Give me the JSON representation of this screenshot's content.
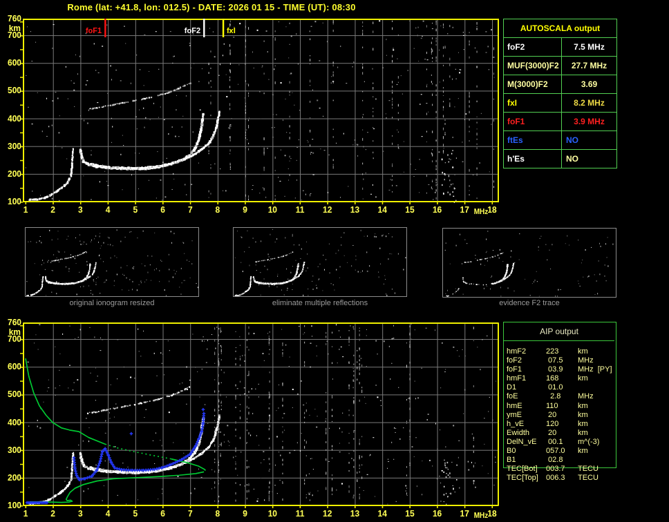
{
  "title": "Rome (lat: +41.8, lon: 012.5) - DATE: 2026 01 15 - TIME (UT): 08:30",
  "colors": {
    "background": "#000000",
    "plot_border": "#f0f000",
    "grid": "#7b7b7b",
    "axis_text": "#ffff55",
    "title_text": "#ffff2e",
    "trace_white": "#ffffff",
    "trace_gray": "#c0c0c0",
    "restored_blue": "#2437f0",
    "profile_green": "#00c832",
    "table_green": "#52d052",
    "caption_gray": "#9c9c9c"
  },
  "autoscala_table": {
    "header": "AUTOSCALA output",
    "rows": [
      {
        "label": "foF2",
        "value": "7.5 MHz",
        "label_color": "#ffffff",
        "value_color": "#ffffff",
        "align": "center"
      },
      {
        "label": "MUF(3000)F2",
        "value": "27.7 MHz",
        "label_color": "#ffffa2",
        "value_color": "#ffffa2",
        "align": "center"
      },
      {
        "label": "M(3000)F2",
        "value": "3.69",
        "label_color": "#ffffa2",
        "value_color": "#ffffa2",
        "align": "center"
      },
      {
        "label": "fxI",
        "value": "8.2 MHz",
        "label_color": "#ffff00",
        "value_color": "#eeda45",
        "align": "center"
      },
      {
        "label": "foF1",
        "value": "3.9 MHz",
        "label_color": "#ff2020",
        "value_color": "#ff2020",
        "align": "center"
      },
      {
        "label": "ftEs",
        "value": "NO",
        "label_color": "#2a62ff",
        "value_color": "#2a62ff",
        "align": "left"
      },
      {
        "label": "h'Es",
        "value": "NO",
        "label_color": "#ffffff",
        "value_color": "#ffffa2",
        "align": "left"
      }
    ]
  },
  "aip_table": {
    "header": "AIP output",
    "rows": [
      {
        "label": "hmF2",
        "value": "223",
        "unit": "km"
      },
      {
        "label": "foF2",
        "value": " 07.5",
        "unit": "MHz"
      },
      {
        "label": "foF1",
        "value": " 03.9",
        "unit": "MHz  [PY]"
      },
      {
        "label": "hmF1",
        "value": "168",
        "unit": "km"
      },
      {
        "label": "D1",
        "value": " 01.0",
        "unit": ""
      },
      {
        "label": "foE",
        "value": "  2.8",
        "unit": "MHz"
      },
      {
        "label": "hmE",
        "value": "110",
        "unit": "km"
      },
      {
        "label": "ymE",
        "value": " 20",
        "unit": "km"
      },
      {
        "label": "h_vE",
        "value": "120",
        "unit": "km"
      },
      {
        "label": "Ewidth",
        "value": " 20",
        "unit": "km"
      },
      {
        "label": "DelN_vE",
        "value": " 00.1",
        "unit": "m^(-3)"
      },
      {
        "label": "B0",
        "value": "057.0",
        "unit": "km"
      },
      {
        "label": "B1",
        "value": " 02.8",
        "unit": ""
      },
      {
        "label": "TEC[Bot]",
        "value": "003.7",
        "unit": "TECU"
      },
      {
        "label": "TEC[Top]",
        "value": "006.3",
        "unit": "TECU"
      }
    ]
  },
  "thumbnails": [
    {
      "caption": "original ionogram resized"
    },
    {
      "caption": "eliminate multiple reflections"
    },
    {
      "caption": "evidence F2 trace"
    }
  ],
  "chart_data": {
    "type": "scatter",
    "title": "ionogram: virtual height (km) vs frequency (MHz), two panels",
    "x_unit": "MHz",
    "y_unit": "km",
    "xlim": [
      1,
      18.25
    ],
    "ylim": [
      100,
      760
    ],
    "x_ticks": [
      1,
      2,
      3,
      4,
      5,
      6,
      7,
      8,
      9,
      10,
      11,
      12,
      13,
      14,
      15,
      16,
      17,
      18
    ],
    "y_ticks": [
      760,
      700,
      600,
      500,
      400,
      300,
      200,
      100
    ],
    "grid": {
      "x_step_mhz": 1,
      "y_step_km": 100
    },
    "markers": [
      {
        "label": "foF1",
        "freq_mhz": 3.9,
        "color": "#ff1414",
        "side": "left"
      },
      {
        "label": "foF2",
        "freq_mhz": 7.5,
        "color": "#ffffff",
        "side": "left"
      },
      {
        "label": "fxI",
        "freq_mhz": 8.2,
        "color": "#ffff00",
        "side": "right"
      }
    ],
    "traces": {
      "E_layer": [
        [
          1.15,
          106
        ],
        [
          1.4,
          108
        ],
        [
          1.7,
          113
        ],
        [
          1.9,
          122
        ],
        [
          2.1,
          135
        ],
        [
          2.3,
          148
        ],
        [
          2.45,
          160
        ],
        [
          2.55,
          172
        ],
        [
          2.62,
          186
        ]
      ],
      "EF_cusp": [
        [
          2.66,
          190
        ],
        [
          2.68,
          215
        ],
        [
          2.7,
          242
        ],
        [
          2.72,
          268
        ],
        [
          2.74,
          292
        ]
      ],
      "F_ordinary": [
        [
          3.0,
          287
        ],
        [
          3.05,
          260
        ],
        [
          3.12,
          244
        ],
        [
          3.3,
          233
        ],
        [
          3.6,
          226
        ],
        [
          4.0,
          222
        ],
        [
          4.5,
          219
        ],
        [
          5.0,
          218
        ],
        [
          5.5,
          220
        ],
        [
          5.9,
          226
        ],
        [
          6.3,
          235
        ],
        [
          6.7,
          250
        ],
        [
          7.0,
          270
        ],
        [
          7.2,
          295
        ],
        [
          7.32,
          325
        ],
        [
          7.4,
          358
        ],
        [
          7.45,
          392
        ],
        [
          7.48,
          418
        ]
      ],
      "F_extraordinary": [
        [
          3.35,
          237
        ],
        [
          3.7,
          229
        ],
        [
          4.1,
          224
        ],
        [
          4.6,
          221
        ],
        [
          5.1,
          221
        ],
        [
          5.6,
          224
        ],
        [
          6.0,
          230
        ],
        [
          6.4,
          240
        ],
        [
          6.8,
          253
        ],
        [
          7.15,
          270
        ],
        [
          7.45,
          290
        ],
        [
          7.7,
          312
        ],
        [
          7.85,
          338
        ],
        [
          7.95,
          368
        ],
        [
          8.02,
          398
        ],
        [
          8.07,
          425
        ]
      ],
      "second_hop": [
        [
          3.2,
          432
        ],
        [
          3.6,
          438
        ],
        [
          4.0,
          445
        ],
        [
          4.5,
          455
        ],
        [
          5.0,
          464
        ],
        [
          5.5,
          474
        ],
        [
          6.0,
          487
        ],
        [
          6.4,
          500
        ],
        [
          6.75,
          515
        ],
        [
          7.0,
          528
        ]
      ]
    },
    "restored_trace_blue": {
      "E_flat": {
        "f_start": 1.05,
        "f_end": 1.82,
        "h": 110
      },
      "main": [
        [
          2.76,
          272
        ],
        [
          2.8,
          232
        ],
        [
          2.86,
          208
        ],
        [
          2.96,
          193
        ],
        [
          3.17,
          197
        ],
        [
          3.42,
          206
        ],
        [
          3.6,
          228
        ],
        [
          3.72,
          260
        ],
        [
          3.8,
          295
        ],
        [
          3.9,
          305
        ],
        [
          4.02,
          280
        ],
        [
          4.12,
          255
        ],
        [
          4.25,
          235
        ],
        [
          4.5,
          229
        ],
        [
          4.9,
          227
        ],
        [
          5.3,
          227
        ],
        [
          5.7,
          230
        ],
        [
          6.0,
          237
        ],
        [
          6.3,
          248
        ],
        [
          6.7,
          266
        ],
        [
          7.0,
          285
        ],
        [
          7.2,
          315
        ],
        [
          7.32,
          342
        ],
        [
          7.42,
          368
        ],
        [
          7.47,
          398
        ],
        [
          7.5,
          438
        ]
      ],
      "outliers": [
        [
          4.85,
          359
        ],
        [
          7.47,
          446
        ]
      ]
    },
    "profile_green": {
      "topside": [
        [
          1.0,
          630
        ],
        [
          1.12,
          565
        ],
        [
          1.3,
          505
        ],
        [
          1.5,
          460
        ],
        [
          1.75,
          425
        ],
        [
          2.0,
          398
        ],
        [
          2.3,
          380
        ],
        [
          2.6,
          372
        ],
        [
          2.95,
          366
        ],
        [
          3.3,
          345
        ],
        [
          3.9,
          321
        ],
        [
          4.4,
          306
        ],
        [
          5.0,
          293
        ],
        [
          5.6,
          281
        ],
        [
          6.3,
          268
        ],
        [
          6.9,
          254
        ],
        [
          7.3,
          242
        ],
        [
          7.52,
          230
        ],
        [
          7.56,
          226
        ]
      ],
      "dotted_f_range": [
        3.9,
        6.3
      ],
      "bottomside": [
        [
          7.5,
          221
        ],
        [
          7.2,
          215
        ],
        [
          6.6,
          209
        ],
        [
          6.0,
          205
        ],
        [
          5.4,
          202
        ],
        [
          4.8,
          199
        ],
        [
          4.2,
          196
        ],
        [
          3.6,
          188
        ],
        [
          3.1,
          175
        ],
        [
          2.8,
          162
        ],
        [
          2.62,
          147
        ],
        [
          2.53,
          132
        ],
        [
          2.48,
          122
        ],
        [
          2.52,
          117
        ],
        [
          2.64,
          119
        ],
        [
          2.7,
          115
        ],
        [
          2.58,
          112
        ],
        [
          2.3,
          111
        ],
        [
          1.9,
          112
        ],
        [
          1.5,
          112
        ],
        [
          1.15,
          113
        ]
      ]
    }
  }
}
